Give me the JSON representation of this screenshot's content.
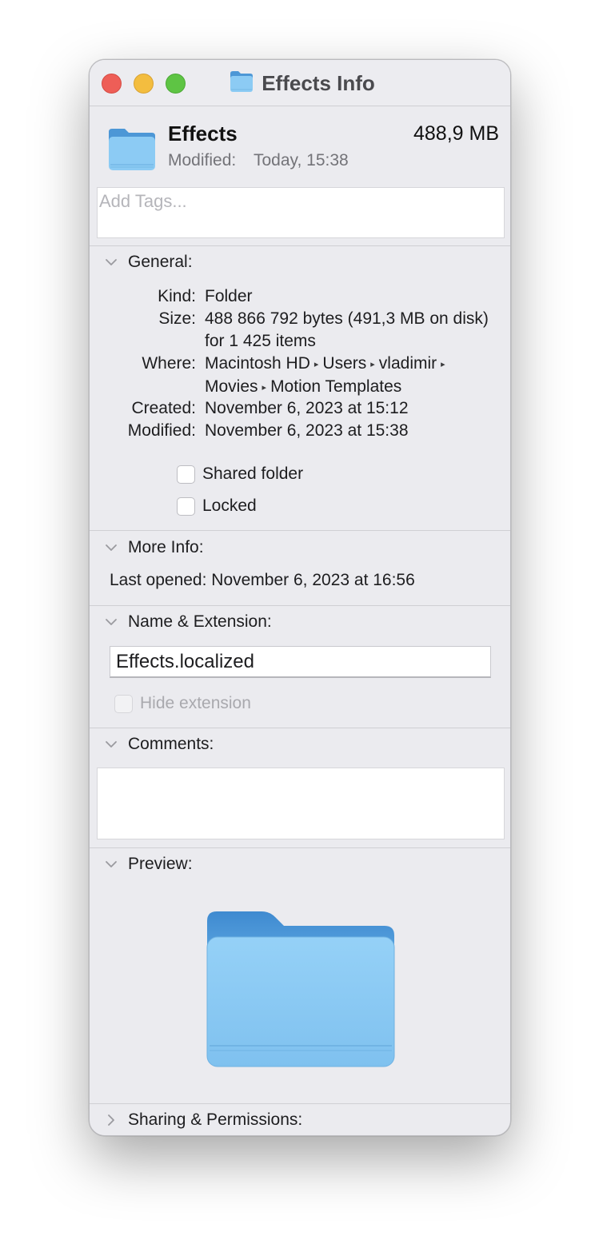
{
  "window": {
    "title": "Effects Info"
  },
  "header": {
    "name": "Effects",
    "size": "488,9 MB",
    "modified_label": "Modified:",
    "modified_value": "Today, 15:38"
  },
  "tags": {
    "placeholder": "Add Tags..."
  },
  "general": {
    "label": "General:",
    "kind_label": "Kind:",
    "kind_value": "Folder",
    "size_label": "Size:",
    "size_value": "488 866 792 bytes (491,3 MB on disk) for 1 425 items",
    "where_label": "Where:",
    "where_path": [
      "Macintosh HD",
      "Users",
      "vladimir",
      "Movies",
      "Motion Templates"
    ],
    "where_separator": "▸",
    "created_label": "Created:",
    "created_value": "November 6, 2023 at 15:12",
    "modified_label": "Modified:",
    "modified_value": "November 6, 2023 at 15:38",
    "shared_folder_label": "Shared folder",
    "shared_folder_checked": false,
    "locked_label": "Locked",
    "locked_checked": false
  },
  "more_info": {
    "label": "More Info:",
    "last_opened_label": "Last opened:",
    "last_opened_value": "November 6, 2023 at 16:56"
  },
  "name_extension": {
    "label": "Name & Extension:",
    "value": "Effects.localized",
    "hide_extension_label": "Hide extension",
    "hide_extension_checked": false,
    "hide_extension_enabled": false
  },
  "comments": {
    "label": "Comments:",
    "value": ""
  },
  "preview": {
    "label": "Preview:"
  },
  "sharing": {
    "label": "Sharing & Permissions:",
    "expanded": false
  },
  "colors": {
    "close": "#ee5e57",
    "minimize": "#f3bd3f",
    "zoom": "#5ec444",
    "folder_front": "#8ccbf4",
    "folder_back": "#4d97d6"
  },
  "icons": {
    "title_icon": "folder-icon",
    "header_icon": "folder-icon",
    "preview_icon": "folder-icon"
  }
}
